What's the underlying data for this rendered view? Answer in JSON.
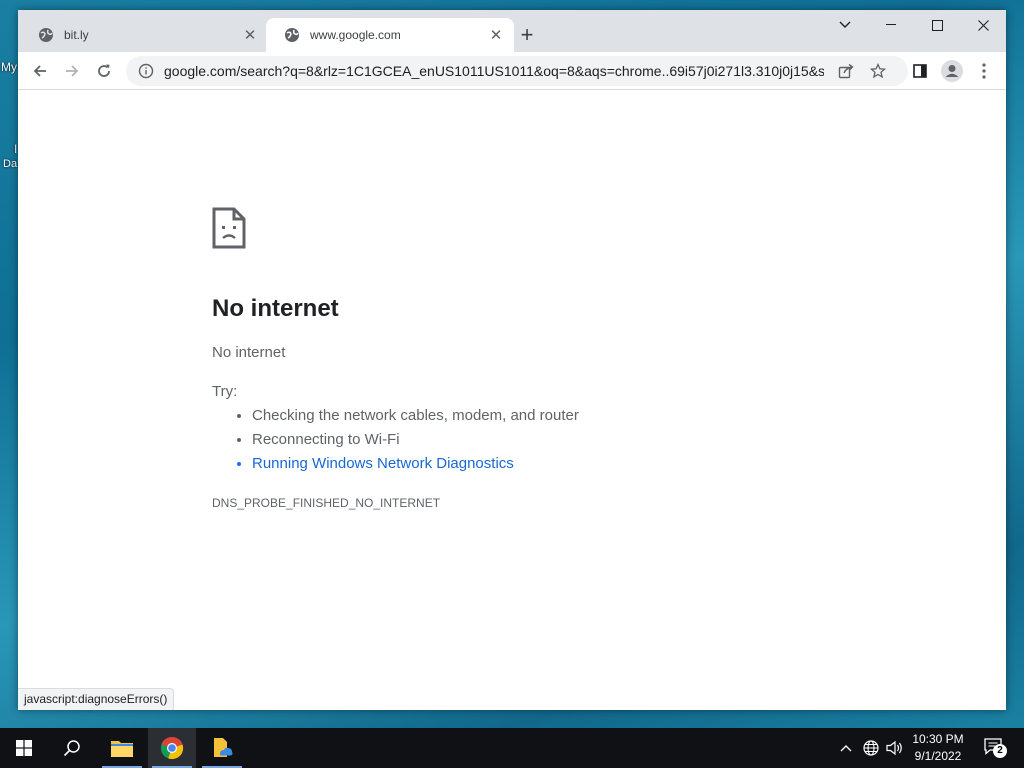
{
  "desktop": {
    "label_1": "My",
    "label_2": "I",
    "label_3": "Da"
  },
  "tabs": [
    {
      "title": "bit.ly"
    },
    {
      "title": "www.google.com"
    }
  ],
  "address_bar": {
    "url": "google.com/search?q=8&rlz=1C1GCEA_enUS1011US1011&oq=8&aqs=chrome..69i57j0i271l3.310j0j15&s..."
  },
  "error_page": {
    "heading": "No internet",
    "subheading": "No internet",
    "try_label": "Try:",
    "suggestions": [
      "Checking the network cables, modem, and router",
      "Reconnecting to Wi-Fi",
      "Running Windows Network Diagnostics"
    ],
    "error_code": "DNS_PROBE_FINISHED_NO_INTERNET"
  },
  "status_bar": {
    "text": "javascript:diagnoseErrors()"
  },
  "taskbar": {
    "time": "10:30 PM",
    "date": "9/1/2022",
    "notification_count": "2"
  },
  "colors": {
    "link": "#1a73e8",
    "tabstrip": "#dee1e6",
    "taskbar": "#0f1115"
  }
}
